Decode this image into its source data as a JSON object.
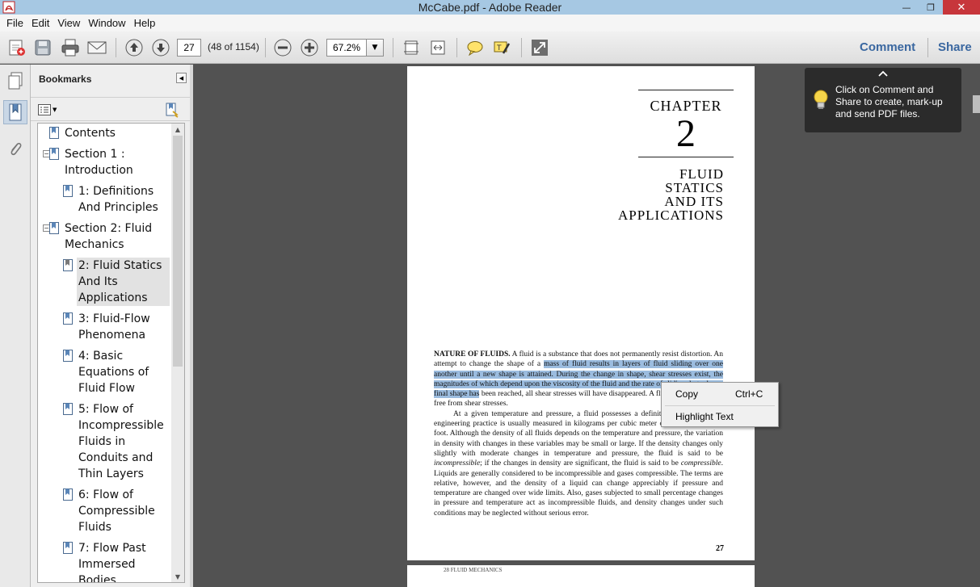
{
  "window": {
    "title": "McCabe.pdf - Adobe Reader"
  },
  "menu": [
    "File",
    "Edit",
    "View",
    "Window",
    "Help"
  ],
  "toolbar": {
    "page_number": "27",
    "page_count": "(48 of 1154)",
    "zoom": "67.2%",
    "comment_label": "Comment",
    "share_label": "Share"
  },
  "bookmarks": {
    "header": "Bookmarks",
    "items": [
      {
        "label_lines": [
          "Contents"
        ],
        "level": 0,
        "toggle": ""
      },
      {
        "label_lines": [
          "Section 1 :",
          "Introduction"
        ],
        "level": 0,
        "toggle": "−"
      },
      {
        "label_lines": [
          "1: Definitions",
          "And Principles"
        ],
        "level": 1,
        "toggle": ""
      },
      {
        "label_lines": [
          "Section 2: Fluid",
          "Mechanics"
        ],
        "level": 0,
        "toggle": "−"
      },
      {
        "label_lines": [
          "2: Fluid Statics",
          "And Its",
          "Applications"
        ],
        "level": 1,
        "toggle": "",
        "selected": true
      },
      {
        "label_lines": [
          "3: Fluid-Flow",
          "Phenomena"
        ],
        "level": 1,
        "toggle": ""
      },
      {
        "label_lines": [
          "4: Basic",
          "Equations of",
          "Fluid Flow"
        ],
        "level": 1,
        "toggle": ""
      },
      {
        "label_lines": [
          "5: Flow of",
          "Incompressible",
          "Fluids in",
          "Conduits and",
          "Thin Layers"
        ],
        "level": 1,
        "toggle": ""
      },
      {
        "label_lines": [
          "6: Flow of",
          "Compressible",
          "Fluids"
        ],
        "level": 1,
        "toggle": ""
      },
      {
        "label_lines": [
          "7: Flow Past",
          "Immersed",
          "Bodies"
        ],
        "level": 1,
        "toggle": ""
      }
    ]
  },
  "document": {
    "chapter_label": "CHAPTER",
    "chapter_number": "2",
    "title_lines": [
      "FLUID",
      "STATICS",
      "AND ITS",
      "APPLICATIONS"
    ],
    "para1_lead": "NATURE OF FLUIDS.",
    "para1_pre": " A fluid is a substance that does not permanently resist distortion. An attempt to change the shape of a ",
    "para1_highlight": "mass of fluid results in layers of fluid sliding over one another until a new shape is attained. During the change in shape, shear stresses exist, the magnitudes of which depend upon the viscosity of the fluid and the rate of sliding, but when a final shape has",
    "para1_post": " been reached, all shear stresses will have disappeared. A fluid in equilibrium is free from shear stresses.",
    "para2_a": "At a given temperature and pressure, a fluid possesses a definite density, which in engineering practice is usually measured in kilograms per cubic meter or pounds per cubic foot. Although the density of all fluids depends on the temperature and pressure, the variation in density with changes in these variables may be small or large. If the density changes only slightly with moderate changes in temperature and pressure, the fluid is said to be ",
    "para2_incompressible": "incompressible",
    "para2_b": "; if the changes in density are significant, the fluid is said to be ",
    "para2_compressible": "compressible",
    "para2_c": ". Liquids are generally considered to be incompressible and gases compressible. The terms are relative, however, and the density of a liquid can change appreciably if pressure and temperature are changed over wide limits. Also, gases subjected to small percentage changes in pressure and temperature act as incompressible fluids, and density changes under such conditions may be neglected without serious error.",
    "page_number": "27",
    "next_page_header": "28    FLUID MECHANICS"
  },
  "context_menu": {
    "copy_label": "Copy",
    "copy_shortcut": "Ctrl+C",
    "highlight_label": "Highlight Text"
  },
  "tip": {
    "text": "Click on Comment and Share to create, mark-up and send PDF files."
  }
}
